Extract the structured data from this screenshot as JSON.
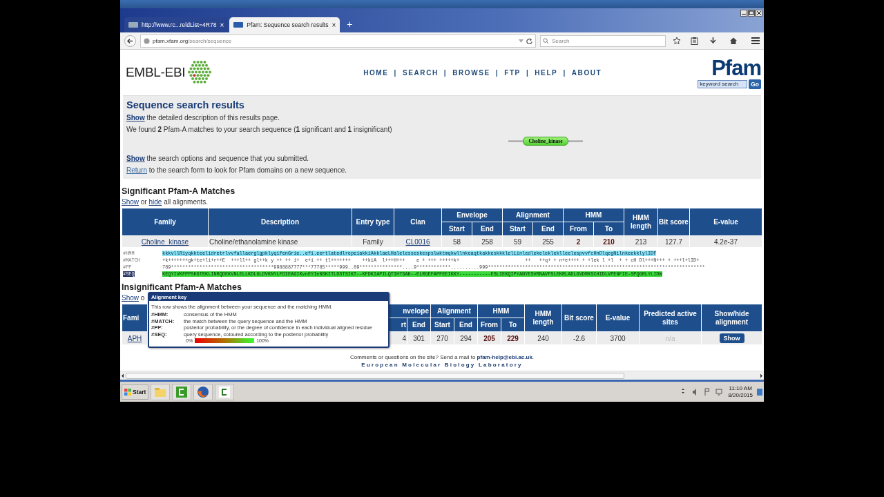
{
  "browser": {
    "tabs": [
      {
        "label": "http://www.rc...reldList=4R78",
        "close": "×",
        "selected": false
      },
      {
        "label": "Pfam: Sequence search results",
        "close": "×",
        "selected": true
      }
    ],
    "new_tab": "+",
    "address": {
      "host": "pfam.xfam.org",
      "path": "/search/sequence"
    },
    "search": {
      "placeholder": "Search"
    }
  },
  "header": {
    "logo": "EMBL-EBI",
    "nav": [
      "HOME",
      "SEARCH",
      "BROWSE",
      "FTP",
      "HELP",
      "ABOUT"
    ],
    "separators": [
      "|",
      "|",
      "|",
      "|",
      "|"
    ],
    "pfam_logo": "Pfam",
    "keyword_search": {
      "placeholder": "keyword search"
    },
    "go_button": "Go"
  },
  "summary": {
    "title": "Sequence search results",
    "lines": [
      {
        "link": "Show",
        "text": " the detailed description of this results page.",
        "kind": "strong"
      },
      {
        "text": "We found **2** Pfam-A matches to your search sequence (**1** significant and **1** insignificant)",
        "kind": "plain"
      }
    ],
    "domain_graphic": {
      "label": "Choline_kinase"
    },
    "lines_after": [
      {
        "link": "Show",
        "text": " the search options and sequence that you submitted.",
        "kind": "strong"
      },
      {
        "link": "Return",
        "text": " to the search form to look for Pfam domains on a new sequence.",
        "kind": "soft"
      }
    ]
  },
  "significant": {
    "title": "Significant Pfam-A Matches",
    "toggle": {
      "show": "Show",
      "middle": " or ",
      "hide": "hide",
      "end": " all alignments."
    },
    "columns": [
      {
        "label": "Family"
      },
      {
        "label": "Description"
      },
      {
        "label": "Entry type"
      },
      {
        "label": "Clan"
      },
      {
        "label": "Envelope",
        "sub": [
          "Start",
          "End"
        ]
      },
      {
        "label": "Alignment",
        "sub": [
          "Start",
          "End"
        ]
      },
      {
        "label": "HMM",
        "sub": [
          "From",
          "To"
        ]
      },
      {
        "label": "HMM length"
      },
      {
        "label": "Bit score"
      },
      {
        "label": "E-value"
      }
    ],
    "row": [
      {
        "text": "Choline_kinase",
        "kind": "link"
      },
      {
        "text": "Choline/ethanolamine kinase",
        "kind": "left"
      },
      {
        "text": "Family",
        "kind": "plain"
      },
      {
        "text": "CL0016",
        "kind": "link"
      },
      {
        "text": "58",
        "kind": "plain"
      },
      {
        "text": "258",
        "kind": "plain"
      },
      {
        "text": "59",
        "kind": "plain"
      },
      {
        "text": "255",
        "kind": "plain"
      },
      {
        "text": "2",
        "kind": "strong"
      },
      {
        "text": "210",
        "kind": "strong"
      },
      {
        "text": "213",
        "kind": "plain"
      },
      {
        "text": "127.7",
        "kind": "plain"
      },
      {
        "text": "4.2e-37",
        "kind": "plain"
      }
    ],
    "alignment": [
      {
        "label": "#HMM",
        "kind": "hmm",
        "selected": false,
        "text": "kkkvllRiyqkkteelidretrlvvfallaerglgpklyqifenGrie..efi.eertlatedlrepeiakkiAkklaeLHalelesseskespslwktmqkwllnkeaqtkakkeskkkleliinledlekelekleklleelespvvfcHnDlqegNilnkeekklylIDF"
      },
      {
        "label": "#MATCH",
        "kind": "match",
        "selected": false,
        "text": "+k+++++++gk+te+li+r++E  +++ll++ gl++k y ++ ++ i+  e+i ++ tl+++++++    ++kiA  l+++H+++    e + +++ +++++k+                       ++   ++q+ + n+e++++ + +lek l +l  + + cH Dl+++N+++ + +++l+lID+"
      },
      {
        "label": "#PP",
        "kind": "pp",
        "selected": false,
        "text": "789************************************9988887777***77785*****999..89***************....9************..........999****************************************************************************"
      },
      {
        "label": "#SEQ",
        "kind": "seq",
        "selected": true,
        "text": "KEQYIVKFPPSKGTEKLINRQDEKVNLELLKDLGLDVKNYLFDIEAGIKvnEYIeNSKITLDSTSIKT--KFDKIAPILQTIHTSAK--ELRGEFAPFEEIKKY-----------ESLIEKQIPYANYESVRNAVFSLEKRLADLGVDRKSCHIDLVPENFIE-SPQGRLYLIDW"
      }
    ]
  },
  "insignificant": {
    "title": "Insignificant Pfam-A Matches",
    "toggle": {
      "show": "Show",
      "rest": "o"
    },
    "columns": [
      {
        "label": "Fami"
      },
      {
        "label": "nvelope",
        "sub": [
          "rt",
          "End"
        ]
      },
      {
        "label": "Alignment",
        "sub": [
          "Start",
          "End"
        ]
      },
      {
        "label": "HMM",
        "sub": [
          "From",
          "To"
        ]
      },
      {
        "label": "HMM length"
      },
      {
        "label": "Bit score"
      },
      {
        "label": "E-value"
      },
      {
        "label": "Predicted active sites"
      },
      {
        "label": "Show/hide alignment"
      }
    ],
    "row": [
      {
        "text": "APH",
        "kind": "link"
      },
      {
        "text": "4",
        "kind": "plain"
      },
      {
        "text": "301",
        "kind": "plain"
      },
      {
        "text": "270",
        "kind": "plain"
      },
      {
        "text": "294",
        "kind": "plain"
      },
      {
        "text": "205",
        "kind": "strong"
      },
      {
        "text": "229",
        "kind": "strong"
      },
      {
        "text": "240",
        "kind": "plain"
      },
      {
        "text": "-2.6",
        "kind": "plain"
      },
      {
        "text": "3700",
        "kind": "plain"
      },
      {
        "text": "n/a",
        "kind": "muted"
      },
      {
        "text": "Show",
        "kind": "button"
      }
    ]
  },
  "tooltip": {
    "title": "Alignment key",
    "intro": "This row shows the alignment between your sequence and the matching HMM.",
    "keys": [
      {
        "key": "#HMM:",
        "desc": "consensus of the HMM"
      },
      {
        "key": "#MATCH:",
        "desc": "the match between the query sequence and the HMM"
      },
      {
        "key": "#PP:",
        "desc": "posterior probability, or the degree of confidence in each individual aligned residue"
      },
      {
        "key": "#SEQ:",
        "desc": "query sequence, coloured according to the posterior probability"
      }
    ],
    "scale": {
      "min": "0%",
      "max": "100%"
    }
  },
  "footer": {
    "text": "Comments or questions on the site? Send a mail to ",
    "email": "pfam-help@ebi.ac.uk",
    "end": ".",
    "org": "European Molecular Biology Laboratory"
  },
  "taskbar": {
    "start": "Start",
    "time": "11:10 AM",
    "date": "8/20/2015"
  }
}
